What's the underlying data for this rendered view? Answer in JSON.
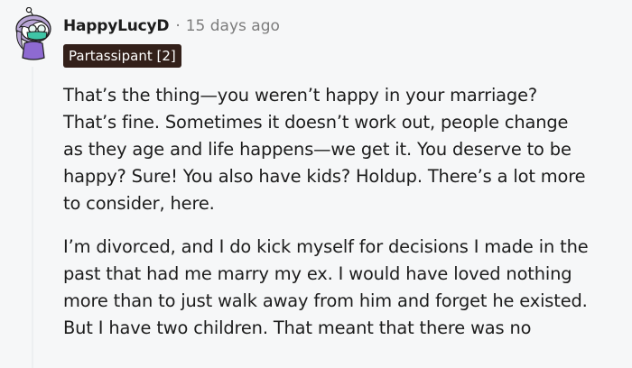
{
  "comment": {
    "username": "HappyLucyD",
    "separator": "·",
    "timestamp": "15 days ago",
    "flair": "Partassipant [2]",
    "paragraphs": [
      {
        "lines": [
          "That’s the thing—you weren’t happy in your marriage?",
          "That’s fine. Sometimes it doesn’t work out, people change",
          "as they age and life happens—we get it. You deserve to be",
          "happy? Sure! You also have kids? Holdup. There’s a lot more",
          "to consider, here."
        ]
      },
      {
        "lines": [
          "I’m divorced, and I do kick myself for decisions I made in the",
          "past that had me marry my ex. I would have loved nothing",
          "more than to just walk away from him and forget he existed.",
          "But I have two children. That meant that there was no"
        ]
      }
    ]
  },
  "colors": {
    "background": "#f6f7f8",
    "flair_bg": "#33201a",
    "avatar_hair": "#b9a6d6",
    "avatar_mask": "#3fc5a6",
    "avatar_shirt": "#8e6ad1"
  },
  "icons": {
    "avatar": "snoo-avatar-icon"
  }
}
